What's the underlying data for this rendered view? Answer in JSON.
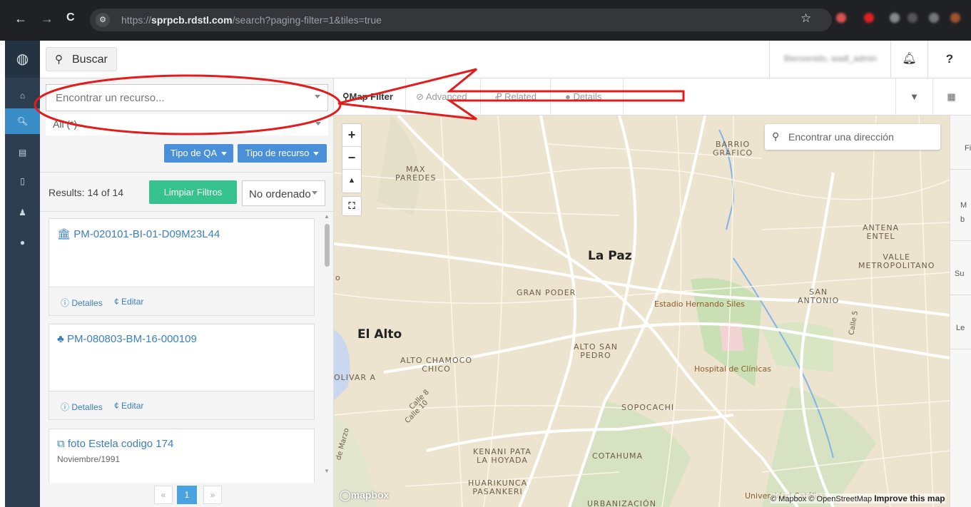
{
  "browser": {
    "url_prefix": "https://",
    "url_domain": "sprpcb.rdstl.com",
    "url_path": "/search?paging-filter=1&tiles=true"
  },
  "topbar": {
    "search_label": "Buscar",
    "user_name": "Bienvenido, wadl_admin",
    "help_label": "?"
  },
  "filters": {
    "find_resource_placeholder": "Encontrar un recurso...",
    "all_value": "All (*)",
    "qa_type_label": "Tipo de QA",
    "resource_type_label": "Tipo de recurso",
    "results_text": "Results: 14 of 14",
    "clear_label": "Limpiar Filtros",
    "order_value": "No ordenado"
  },
  "results": [
    {
      "icon": "museum-icon",
      "title": "PM-020101-BI-01-D09M23L44",
      "subtitle": "",
      "details": "Detalles",
      "edit": "Editar"
    },
    {
      "icon": "bell-icon",
      "title": "PM-080803-BM-16-000109",
      "subtitle": "",
      "details": "Detalles",
      "edit": "Editar"
    },
    {
      "icon": "image-icon",
      "title": "foto Estela codigo 174",
      "subtitle": "Noviembre/1991"
    }
  ],
  "pager": {
    "prev": "«",
    "current": "1",
    "next": "»"
  },
  "tabs": [
    {
      "label": "Map Filter",
      "active": true
    },
    {
      "label": "Advanced",
      "active": false
    },
    {
      "label": "Related",
      "active": false
    },
    {
      "label": "Details",
      "active": false
    }
  ],
  "map": {
    "address_placeholder": "Encontrar una dirección",
    "logo_text": "mapbox",
    "attribution": "© Mapbox © OpenStreetMap",
    "improve": "Improve this map",
    "places": {
      "la_paz": "La Paz",
      "el_alto": "El Alto",
      "barrio_grafico": "BARRIO\nGRÁFICO",
      "max_paredes": "MAX\nPAREDES",
      "antena_entel": "ANTENA\nENTEL",
      "valle_metropolitano": "VALLE\nMETROPOLITANO",
      "gran_poder": "GRAN PODER",
      "san_antonio": "SAN\nANTONIO",
      "estadio": "Estadio Hernando Siles",
      "alto_san_pedro": "ALTO SAN\nPEDRO",
      "alto_chamoco_chico": "ALTO CHAMOCO\nCHICO",
      "hospital": "Hospital de Clínicas",
      "bolivar_a": "OLIVAR A",
      "sopocachi": "SOPOCACHI",
      "kenani_pata": "KENANI PATA\nLA HOYADA",
      "cotahuma": "COTAHUMA",
      "huarikunca": "HUARIKUNCA\nPASANKERI",
      "urbanizacion": "URBANIZACIÓN",
      "universidad": "Universidad Católica",
      "calle_8": "Calle 8",
      "calle_10": "Calle 10",
      "calle_5": "Calle 5",
      "de_marzo": "de Marzo",
      "o_label": "o"
    }
  },
  "right_panel": [
    "Fi",
    "M\nb",
    "Su",
    "Le"
  ],
  "colors": {
    "rail": "#2c3e50",
    "accent": "#3a8ec8",
    "button_blue": "#4a90d9",
    "button_green": "#35c28e",
    "link": "#3a7fc1",
    "annotation_red": "#e31b1b"
  }
}
